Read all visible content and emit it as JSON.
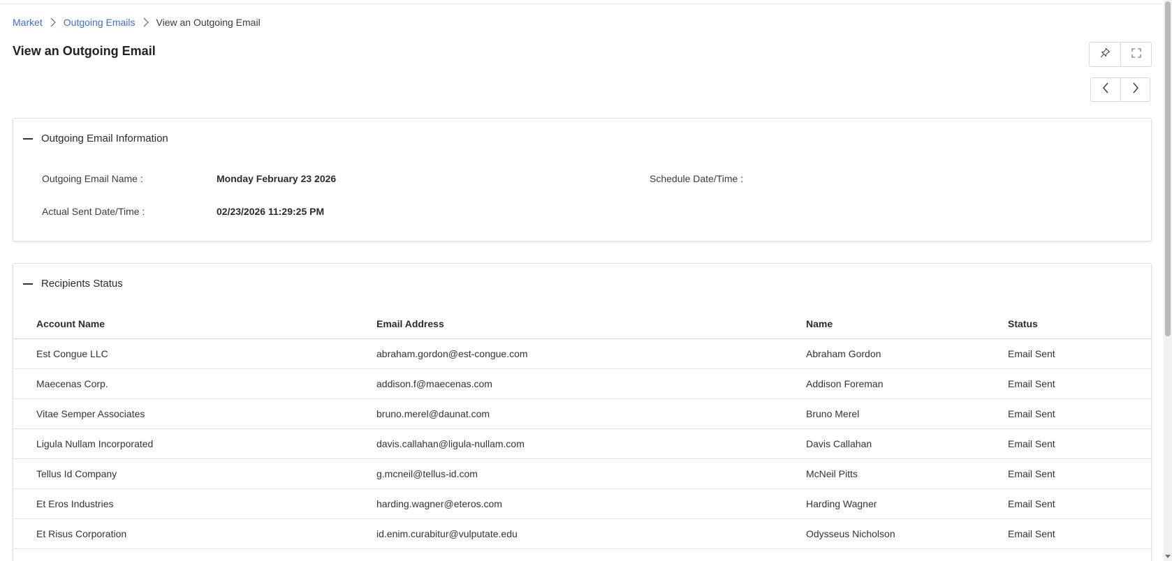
{
  "breadcrumb": {
    "items": [
      "Market",
      "Outgoing Emails"
    ],
    "current": "View an Outgoing Email"
  },
  "page": {
    "title": "View an Outgoing Email"
  },
  "toolbar": {
    "pin_icon": "pin-icon",
    "fullscreen_icon": "expand-icon",
    "prev_icon": "chevron-left-icon",
    "next_icon": "chevron-right-icon"
  },
  "info_section": {
    "title": "Outgoing Email Information",
    "fields": {
      "name_label": "Outgoing Email Name :",
      "name_value": "Monday February 23 2026",
      "schedule_label": "Schedule Date/Time :",
      "schedule_value": "",
      "sent_label": "Actual Sent Date/Time :",
      "sent_value": "02/23/2026 11:29:25 PM"
    }
  },
  "recipients_section": {
    "title": "Recipients Status",
    "columns": [
      "Account Name",
      "Email Address",
      "Name",
      "Status"
    ],
    "rows": [
      [
        "Est Congue LLC",
        "abraham.gordon@est-congue.com",
        "Abraham Gordon",
        "Email Sent"
      ],
      [
        "Maecenas Corp.",
        "addison.f@maecenas.com",
        "Addison Foreman",
        "Email Sent"
      ],
      [
        "Vitae Semper Associates",
        "bruno.merel@daunat.com",
        "Bruno Merel",
        "Email Sent"
      ],
      [
        "Ligula Nullam Incorporated",
        "davis.callahan@ligula-nullam.com",
        "Davis Callahan",
        "Email Sent"
      ],
      [
        "Tellus Id Company",
        "g.mcneil@tellus-id.com",
        "McNeil Pitts",
        "Email Sent"
      ],
      [
        "Et Eros Industries",
        "harding.wagner@eteros.com",
        "Harding Wagner",
        "Email Sent"
      ],
      [
        "Et Risus Corporation",
        "id.enim.curabitur@vulputate.edu",
        "Odysseus Nicholson",
        "Email Sent"
      ]
    ]
  },
  "colors": {
    "link": "#3f6fc7",
    "border": "#e2e2e2",
    "text": "#2b2b2b"
  }
}
